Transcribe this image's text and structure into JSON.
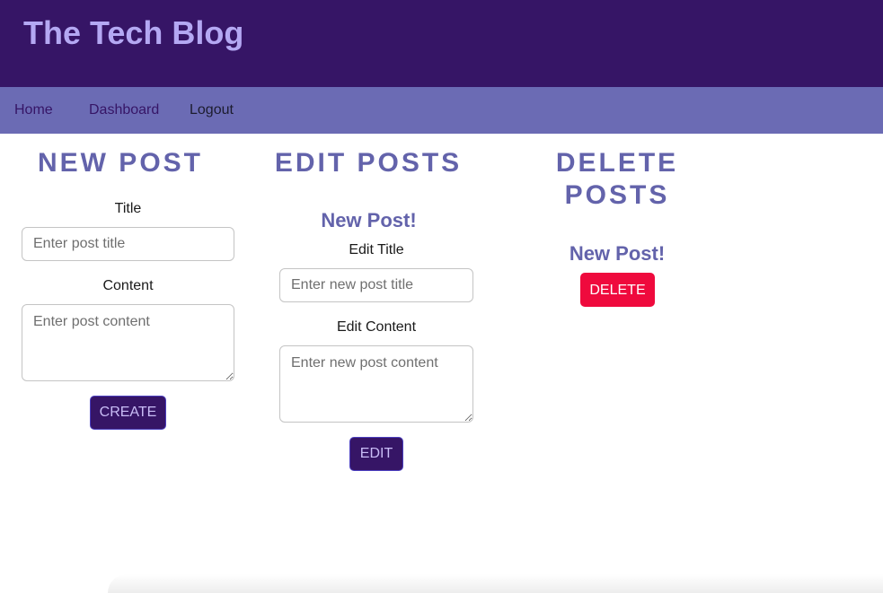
{
  "header": {
    "site_title": "The Tech Blog"
  },
  "nav": {
    "home": "Home",
    "dashboard": "Dashboard",
    "logout": "Logout"
  },
  "new_post": {
    "heading": "NEW POST",
    "title_label": "Title",
    "title_placeholder": "Enter post title",
    "content_label": "Content",
    "content_placeholder": "Enter post content",
    "create_button": "CREATE"
  },
  "edit_posts": {
    "heading": "EDIT POSTS",
    "post_title": "New Post!",
    "title_label": "Edit Title",
    "title_placeholder": "Enter new post title",
    "content_label": "Edit Content",
    "content_placeholder": "Enter new post content",
    "edit_button": "EDIT"
  },
  "delete_posts": {
    "heading_line1": "DELETE",
    "heading_line2": "POSTS",
    "post_title": "New Post!",
    "delete_button": "DELETE"
  },
  "colors": {
    "header_bg": "#361566",
    "nav_bg": "#6b6bb4",
    "title_text": "#b4a8f3",
    "heading_text": "#6363ab",
    "primary_button": "#361566",
    "danger_button": "#ef0a3d"
  }
}
